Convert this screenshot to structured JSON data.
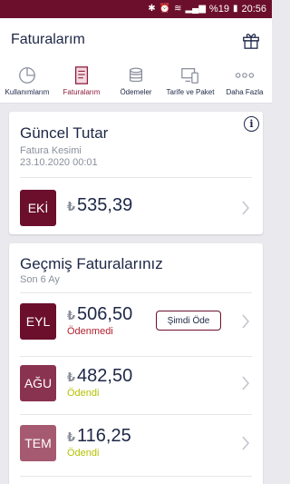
{
  "status_bar": {
    "battery_percent": "%19",
    "time": "20:56"
  },
  "header": {
    "title": "Faturalarım"
  },
  "tabs": [
    {
      "label": "Kullanımlarım",
      "icon": "pie-chart-icon"
    },
    {
      "label": "Faturalarım",
      "icon": "invoice-icon",
      "active": true
    },
    {
      "label": "Ödemeler",
      "icon": "coins-icon"
    },
    {
      "label": "Tarife ve Paket",
      "icon": "devices-icon"
    },
    {
      "label": "Daha Fazla",
      "icon": "more-dots-icon"
    }
  ],
  "current_bill": {
    "title": "Güncel Tutar",
    "subtitle": "Fatura Kesimi",
    "date": "23.10.2020 00:01",
    "month": "EKİ",
    "currency_symbol": "₺",
    "amount": "535,39"
  },
  "past_bills": {
    "title": "Geçmiş Faturalarınız",
    "subtitle": "Son 6 Ay",
    "items": [
      {
        "month": "EYL",
        "currency_symbol": "₺",
        "amount": "506,50",
        "status": "Ödenmedi",
        "pay_label": "Şimdi Öde"
      },
      {
        "month": "AĞU",
        "currency_symbol": "₺",
        "amount": "482,50",
        "status": "Ödendi"
      },
      {
        "month": "TEM",
        "currency_symbol": "₺",
        "amount": "116,25",
        "status": "Ödendi"
      }
    ]
  },
  "colors": {
    "brand": "#6b0f2c",
    "text_primary": "#1d2746",
    "unpaid": "#b0202e",
    "paid": "#b5c000",
    "month_eki": "#6b0f2c",
    "month_eyl": "#6b0f2c",
    "month_agu": "#8a3350",
    "month_tem": "#a65a72"
  }
}
